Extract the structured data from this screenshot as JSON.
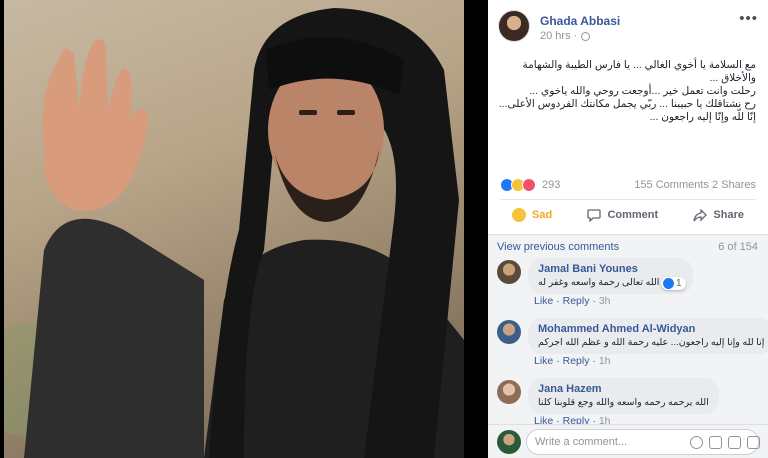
{
  "post": {
    "author": "Ghada Abbasi",
    "time": "20 hrs ·",
    "more_label": "•••",
    "text_lines": [
      "مع السلامة يا أخوي الغالي ... يا فارس الطيبة والشهامة والأخلاق ...",
      "رحلت وانت تعمل خير ...أوجعت روحي والله ياخوي ...",
      "رح نشتاقلك يا حبيبنا ... ربّي يجمل مكانتك الفردوس الأعلى...",
      "إنّا للّه وإنّا إليه راجعون ..."
    ],
    "reactions_count": "293",
    "comments_count": "155 Comments",
    "shares_count": "2 Shares",
    "actions": {
      "sad": "Sad",
      "comment": "Comment",
      "share": "Share"
    }
  },
  "comments_section": {
    "view_previous": "View previous comments",
    "count": "6 of 154",
    "like_label": "Like",
    "reply_label": "Reply",
    "items": [
      {
        "name": "Jamal Bani Younes",
        "text": "رحمه الله تعالى رحمة واسعه وغفر له",
        "time": "3h",
        "reaction_count": "1"
      },
      {
        "name": "Mohammed Ahmed Al-Widyan",
        "text": "إنا لله وإنا إليه راجعون... عليه رحمة الله و عظم الله اجركم",
        "time": "1h"
      },
      {
        "name": "Jana Hazem",
        "text": "الله يرحمه رحمه واسعه والله وجع قلوبنا كلنا",
        "time": "1h"
      }
    ]
  },
  "write_comment": {
    "placeholder": "Write a comment..."
  },
  "colors": {
    "link": "#385898",
    "sad": "#f5a623",
    "like": "#2078f4",
    "love": "#f25268"
  }
}
